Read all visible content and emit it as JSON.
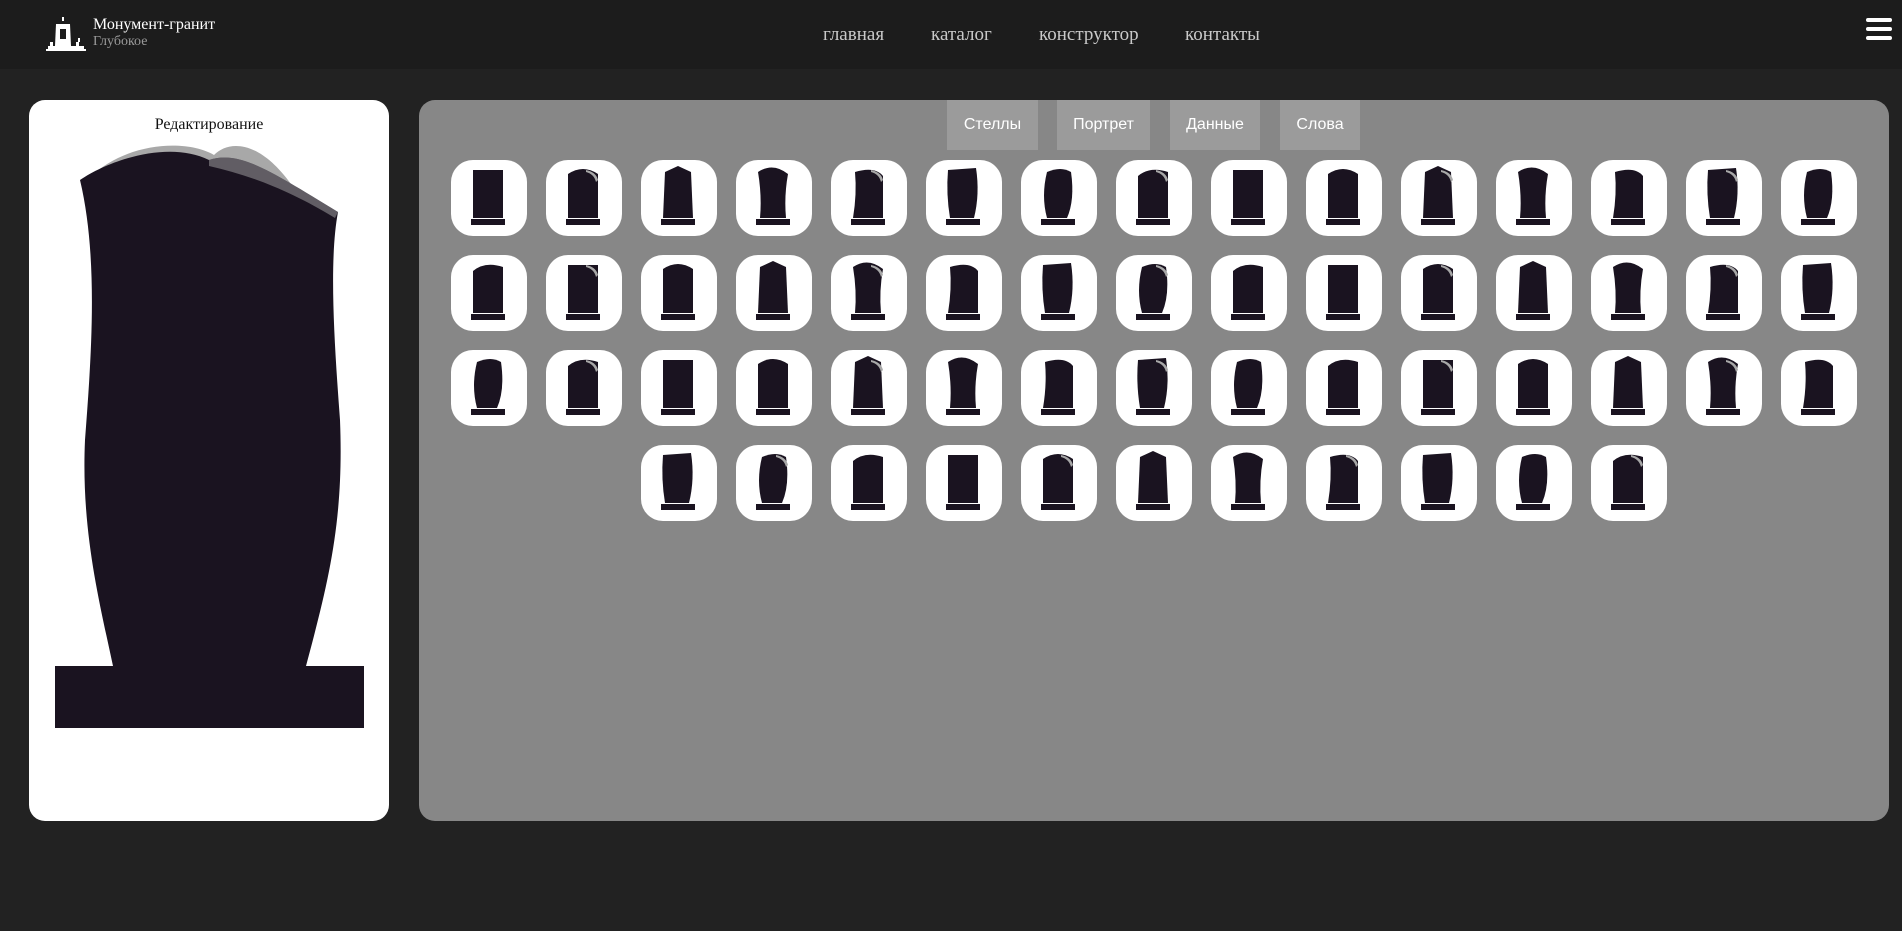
{
  "header": {
    "brand_name": "Монумент-гранит",
    "brand_sub": "Глубокое",
    "nav": [
      "главная",
      "каталог",
      "конструктор",
      "контакты"
    ]
  },
  "preview": {
    "title": "Редактирование"
  },
  "tabs": [
    "Стеллы",
    "Портрет",
    "Данные",
    "Слова"
  ],
  "catalog": {
    "rows": [
      15,
      15,
      15,
      11
    ]
  },
  "colors": {
    "page_bg": "#222222",
    "header_bg": "#1c1c1c",
    "panel_bg": "#878787",
    "tab_bg": "#9b9b9b",
    "stone": "#1a1320",
    "stone_highlight": "#a8a8a8"
  }
}
